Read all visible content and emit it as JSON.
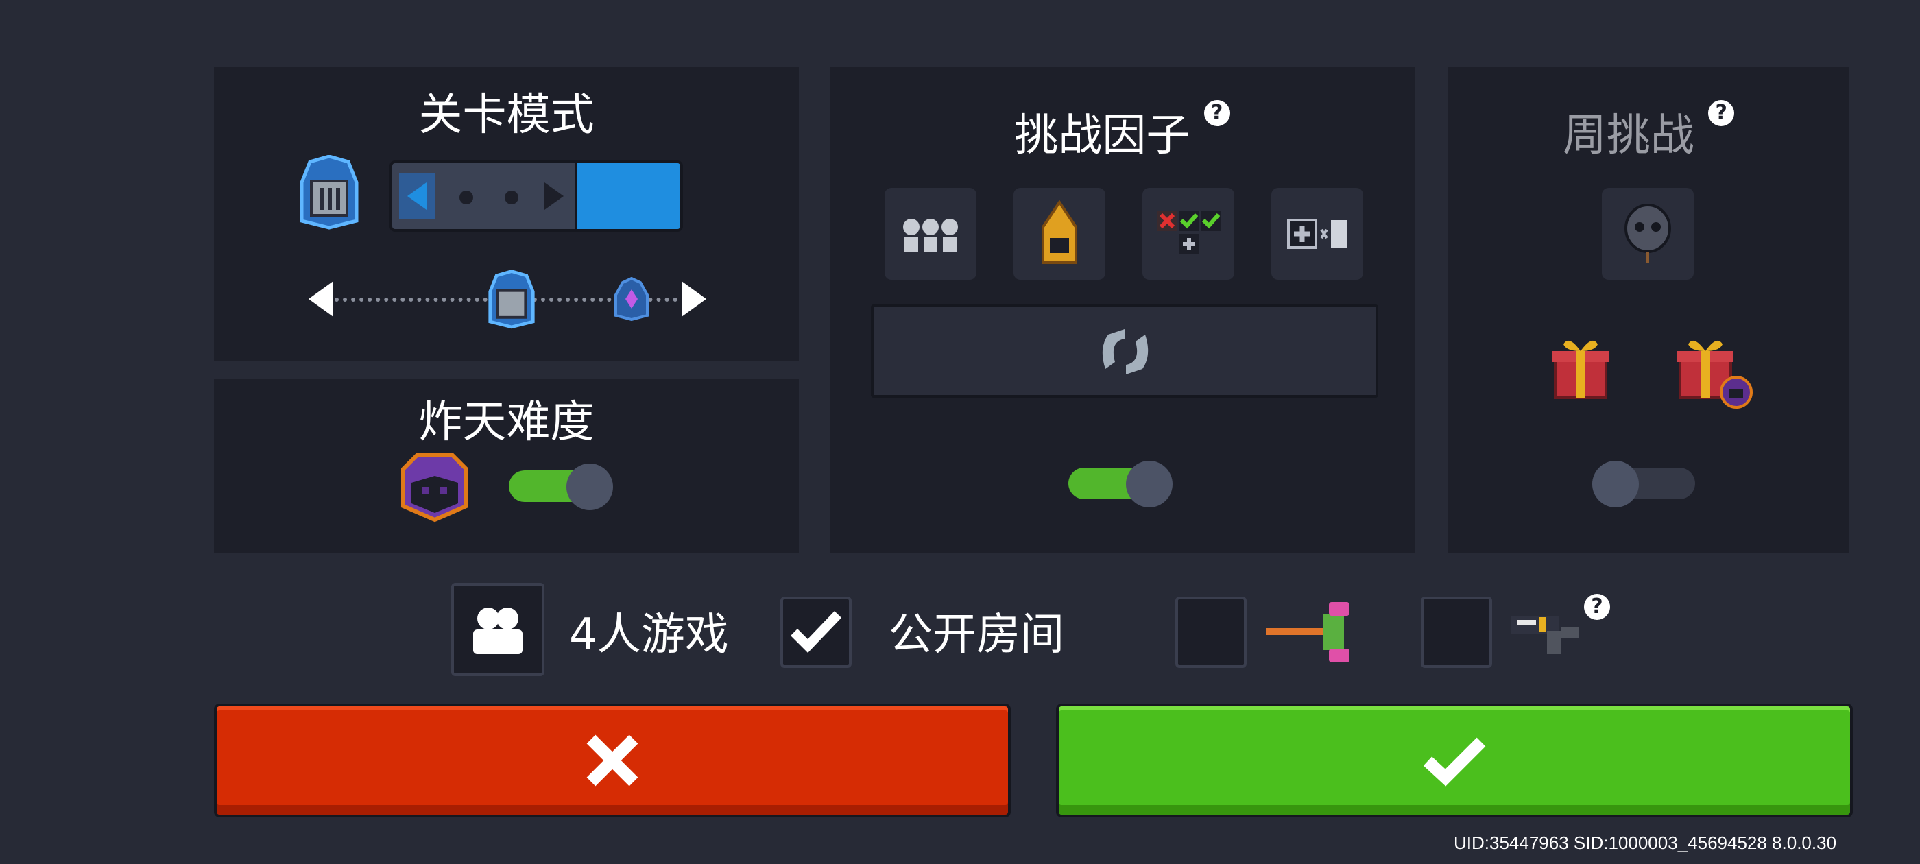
{
  "level_mode": {
    "title": "关卡模式"
  },
  "detonate": {
    "title": "炸天难度",
    "toggle_on": true
  },
  "challenge_factors": {
    "title": "挑战因子",
    "help_icon": "question-icon",
    "toggle_on": true,
    "slots": [
      "skeleton-trio-icon",
      "golden-helmet-icon",
      "check-cross-grid-icon",
      "plus-times-icon"
    ],
    "refresh_icon": "refresh-icon"
  },
  "weekly": {
    "title": "周挑战",
    "help_icon": "question-icon",
    "toggle_on": false,
    "rewards": [
      "gift-box-icon",
      "gift-box-demon-icon"
    ]
  },
  "options": {
    "multiplayer_label": "4人游戏",
    "public_room_label": "公开房间",
    "public_room_checked": true
  },
  "buttons": {
    "cancel_icon": "close-icon",
    "confirm_icon": "check-icon"
  },
  "colors": {
    "cancel": "#d62c04",
    "confirm": "#4bbf1d",
    "accent": "#1f8ee0",
    "toggle_on": "#52b62c"
  },
  "footer": {
    "ids": "UID:35447963 SID:1000003_45694528 8.0.0.30"
  }
}
